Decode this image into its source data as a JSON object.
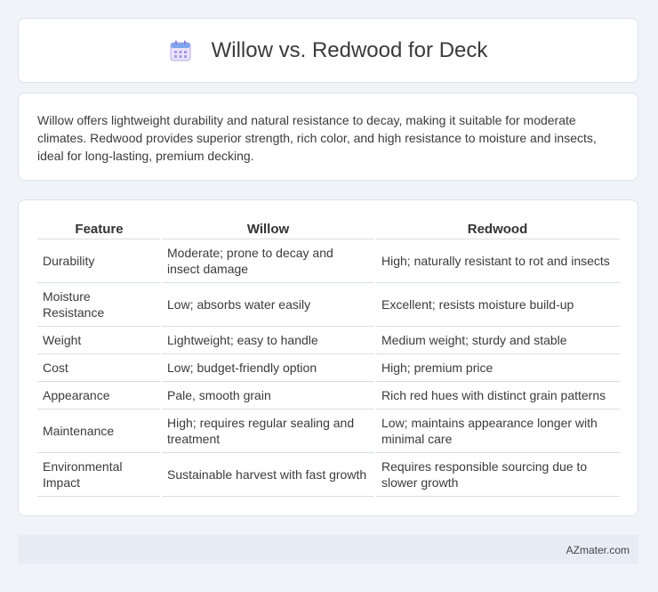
{
  "header": {
    "title": "Willow vs. Redwood for Deck",
    "icon": "calendar-icon"
  },
  "summary": {
    "text": "Willow offers lightweight durability and natural resistance to decay, making it suitable for moderate climates. Redwood provides superior strength, rich color, and high resistance to moisture and insects, ideal for long-lasting, premium decking."
  },
  "table": {
    "headers": [
      "Feature",
      "Willow",
      "Redwood"
    ],
    "rows": [
      [
        "Durability",
        "Moderate; prone to decay and insect damage",
        "High; naturally resistant to rot and insects"
      ],
      [
        "Moisture Resistance",
        "Low; absorbs water easily",
        "Excellent; resists moisture build-up"
      ],
      [
        "Weight",
        "Lightweight; easy to handle",
        "Medium weight; sturdy and stable"
      ],
      [
        "Cost",
        "Low; budget-friendly option",
        "High; premium price"
      ],
      [
        "Appearance",
        "Pale, smooth grain",
        "Rich red hues with distinct grain patterns"
      ],
      [
        "Maintenance",
        "High; requires regular sealing and treatment",
        "Low; maintains appearance longer with minimal care"
      ],
      [
        "Environmental Impact",
        "Sustainable harvest with fast growth",
        "Requires responsible sourcing due to slower growth"
      ]
    ]
  },
  "footer": {
    "text": "AZmater.com"
  }
}
